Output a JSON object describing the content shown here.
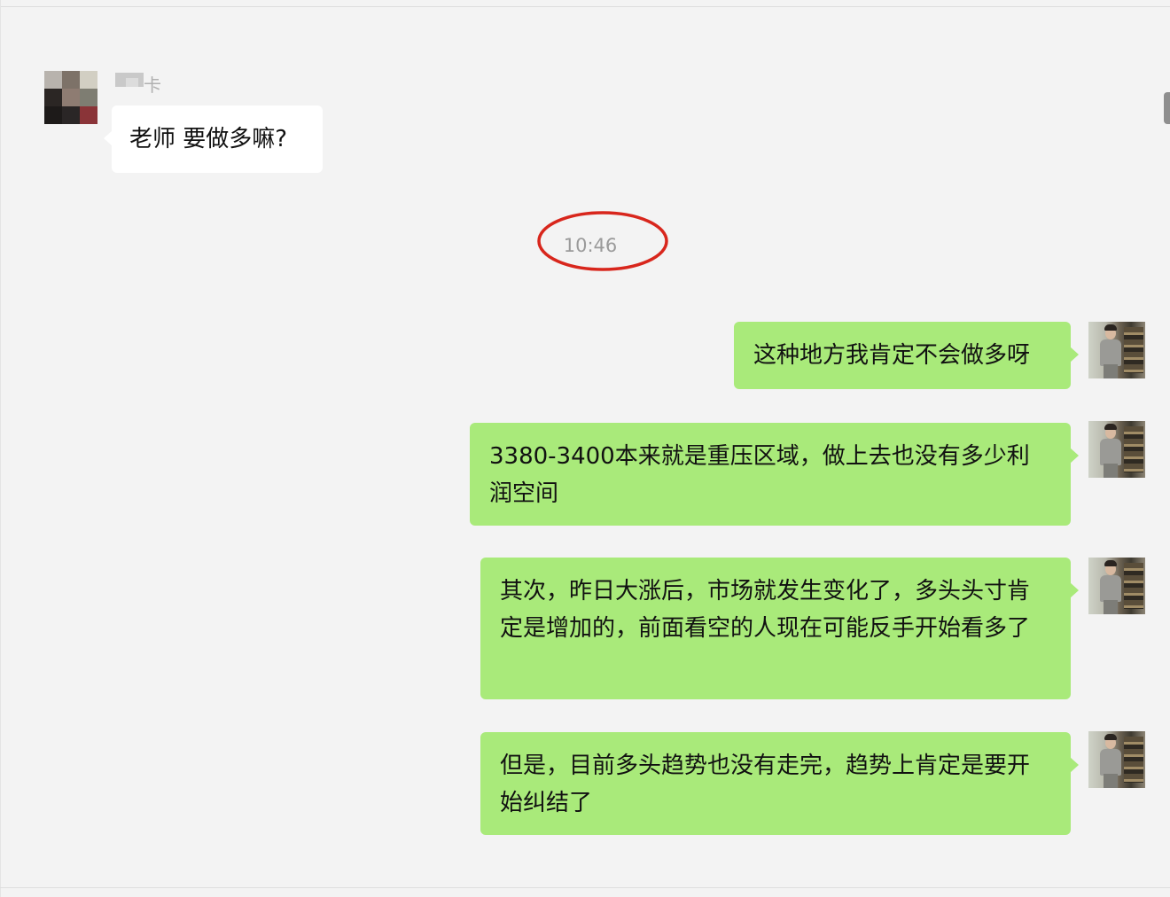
{
  "incoming": {
    "sender_name_fragment": "卡",
    "message": "老师 要做多嘛?"
  },
  "timestamp": "10:46",
  "outgoing": [
    {
      "text": "这种地方我肯定不会做多呀"
    },
    {
      "text": "3380-3400本来就是重压区域，做上去也没有多少利润空间"
    },
    {
      "text": "其次，昨日大涨后，市场就发生变化了，多头头寸肯定是增加的，前面看空的人现在可能反手开始看多了"
    },
    {
      "text": "但是，目前多头趋势也没有走完，趋势上肯定是要开始纠结了"
    }
  ],
  "colors": {
    "background": "#f3f3f3",
    "incoming_bubble": "#ffffff",
    "outgoing_bubble": "#a9ea7a",
    "timestamp_text": "#9a9a9a",
    "annotation_circle": "#d8261c"
  },
  "icons": {
    "incoming_avatar": "pixelated-avatar",
    "outgoing_avatar": "user-photo-avatar"
  }
}
